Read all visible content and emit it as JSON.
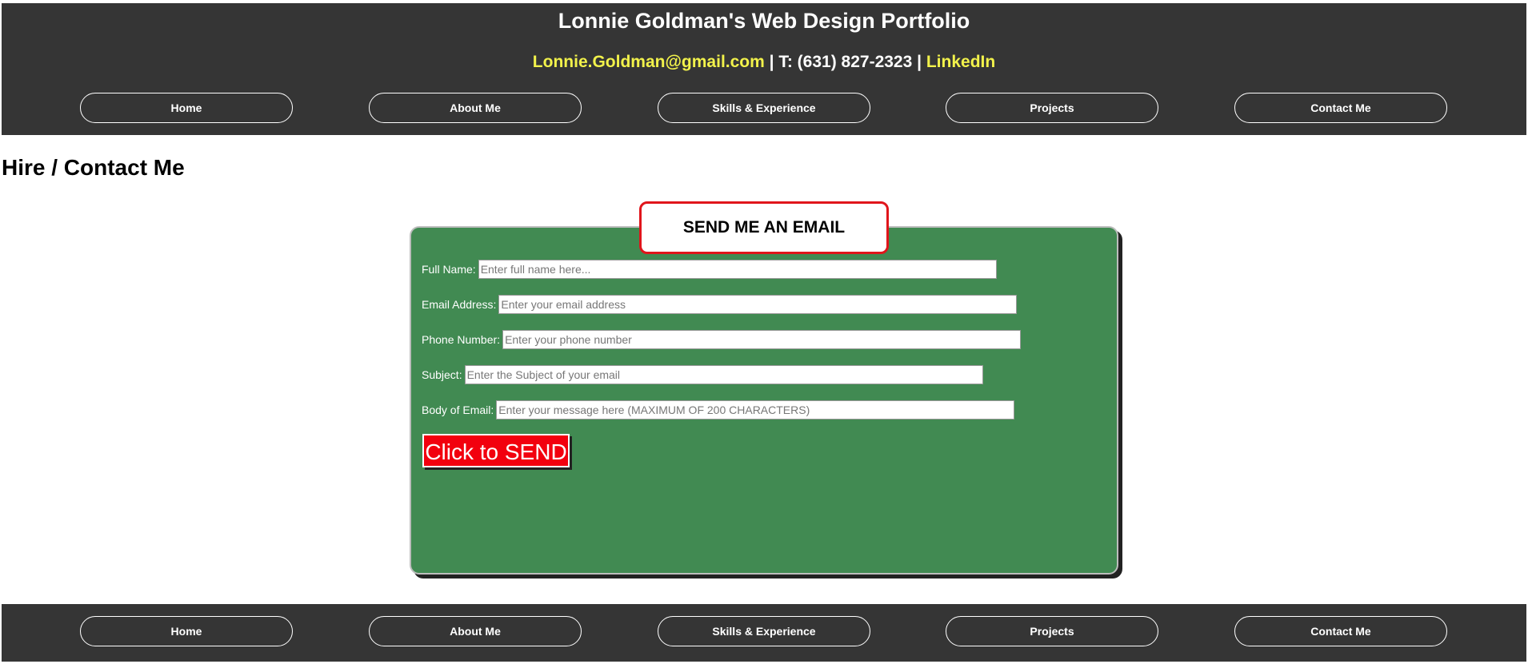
{
  "header": {
    "title": "Lonnie Goldman's Web Design Portfolio",
    "email": "Lonnie.Goldman@gmail.com",
    "separator_1": " | ",
    "phone": "T: (631) 827-2323",
    "separator_2": " | ",
    "linkedin": "LinkedIn"
  },
  "nav": {
    "items": [
      {
        "label": "Home"
      },
      {
        "label": "About Me"
      },
      {
        "label": "Skills & Experience"
      },
      {
        "label": "Projects"
      },
      {
        "label": "Contact Me"
      }
    ]
  },
  "page": {
    "heading": "Hire / Contact Me"
  },
  "form": {
    "badge": "SEND ME AN EMAIL",
    "fields": [
      {
        "label": "Full Name:",
        "placeholder": "Enter full name here...",
        "value": ""
      },
      {
        "label": "Email Address:",
        "placeholder": "Enter your email address",
        "value": ""
      },
      {
        "label": "Phone Number:",
        "placeholder": "Enter your phone number",
        "value": ""
      },
      {
        "label": "Subject:",
        "placeholder": "Enter the Subject of your email",
        "value": ""
      },
      {
        "label": "Body of Email:",
        "placeholder": "Enter your message here (MAXIMUM OF 200 CHARACTERS)",
        "value": ""
      }
    ],
    "submit_label": "Click to SEND"
  },
  "colors": {
    "header_bg": "#353535",
    "link_yellow": "#f2f24b",
    "form_bg": "#418a52",
    "badge_border": "#e0151b",
    "send_button": "#f2000e"
  }
}
